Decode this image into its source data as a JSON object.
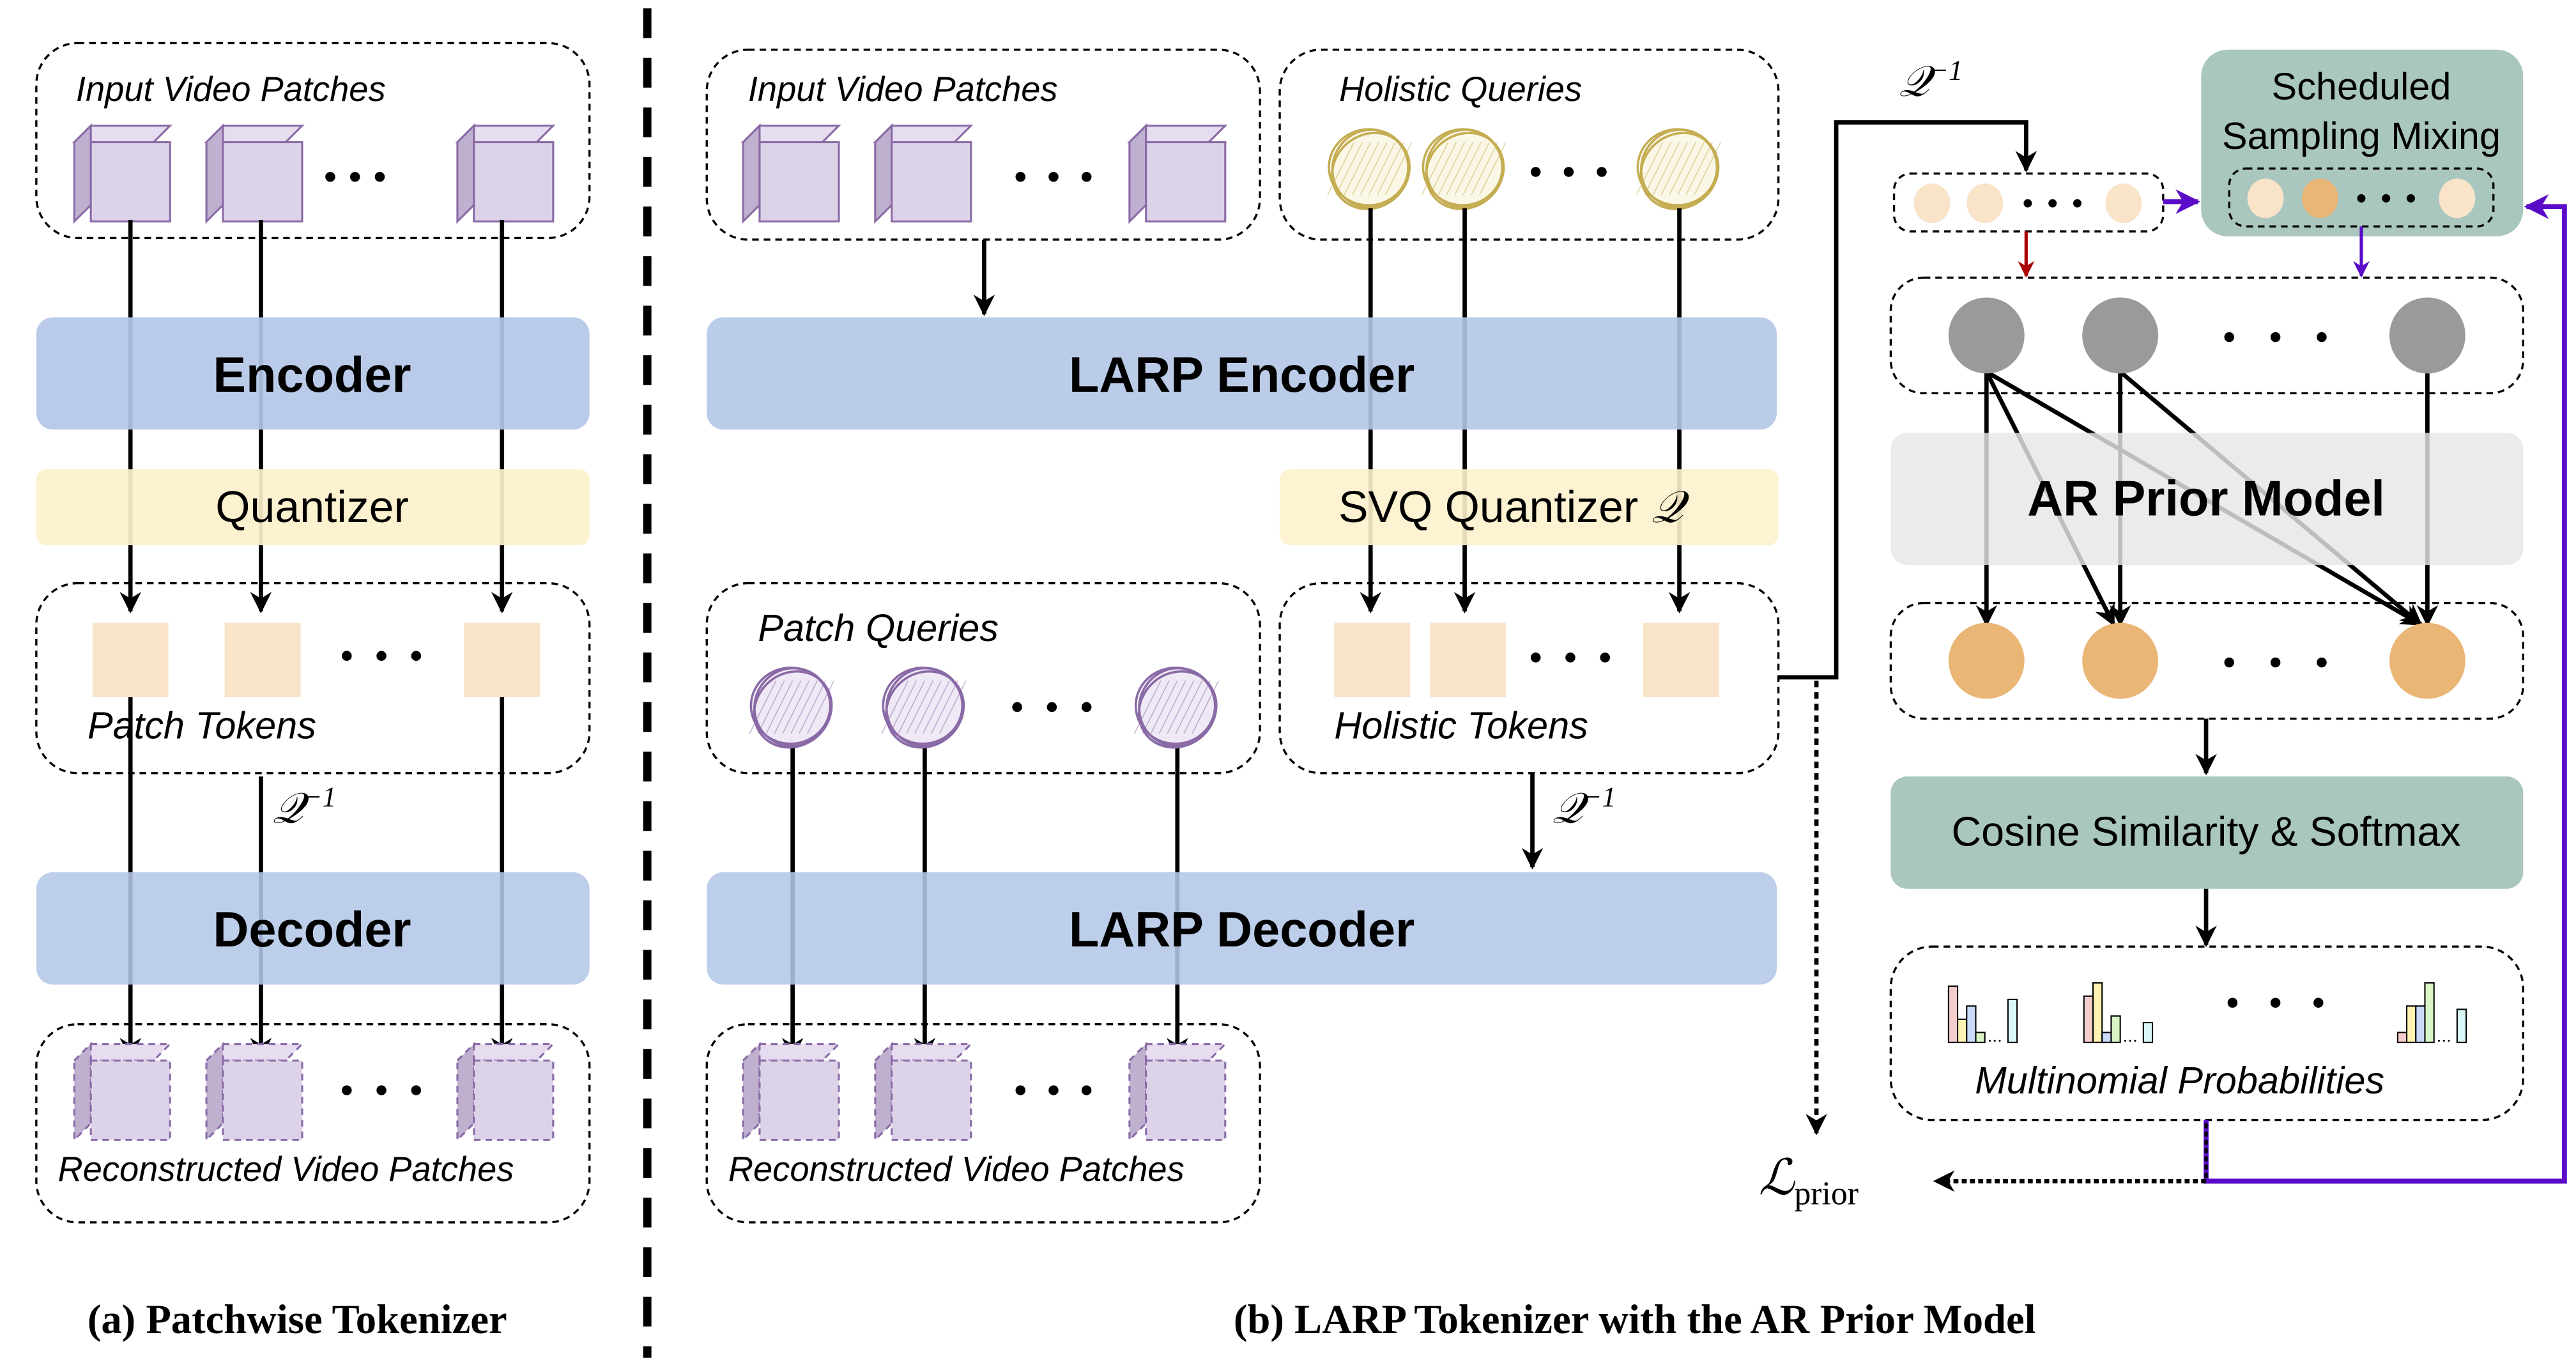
{
  "panel_a": {
    "input_label": "Input Video Patches",
    "encoder": "Encoder",
    "quantizer": "Quantizer",
    "tokens_label": "Patch Tokens",
    "inverse_q": {
      "symbol": "𝒬",
      "exp": "−1"
    },
    "decoder": "Decoder",
    "recon_label": "Reconstructed Video Patches",
    "caption": "(a) Patchwise Tokenizer"
  },
  "panel_b": {
    "input_label": "Input Video Patches",
    "queries_label": "Holistic Queries",
    "encoder": "LARP Encoder",
    "quantizer": "SVQ Quantizer",
    "quantizer_symbol": "𝒬",
    "patch_queries_label": "Patch Queries",
    "tokens_label": "Holistic Tokens",
    "inverse_q": {
      "symbol": "𝒬",
      "exp": "−1"
    },
    "decoder": "LARP Decoder",
    "recon_label": "Reconstructed Video Patches",
    "caption": "(b) LARP Tokenizer with the AR Prior Model"
  },
  "prior": {
    "inverse_q": {
      "symbol": "𝒬",
      "exp": "−1"
    },
    "mixing_line1": "Scheduled",
    "mixing_line2": "Sampling Mixing",
    "model": "AR Prior Model",
    "cosine": "Cosine Similarity & Softmax",
    "probs_label": "Multinomial Probabilities",
    "loss": {
      "symbol": "ℒ",
      "sub": "prior"
    }
  },
  "colors": {
    "encoder": "#b4c7e7",
    "quantizer": "#fdf1cc",
    "token": "#f9e3c9",
    "mixing": "#a9c6bf",
    "ar_model": "#e6e6e6",
    "prior_input": "#9a9a9a",
    "prior_output": "#eab676",
    "feedback": "#5a0bc8",
    "teacher_arrow": "#aa0000"
  }
}
